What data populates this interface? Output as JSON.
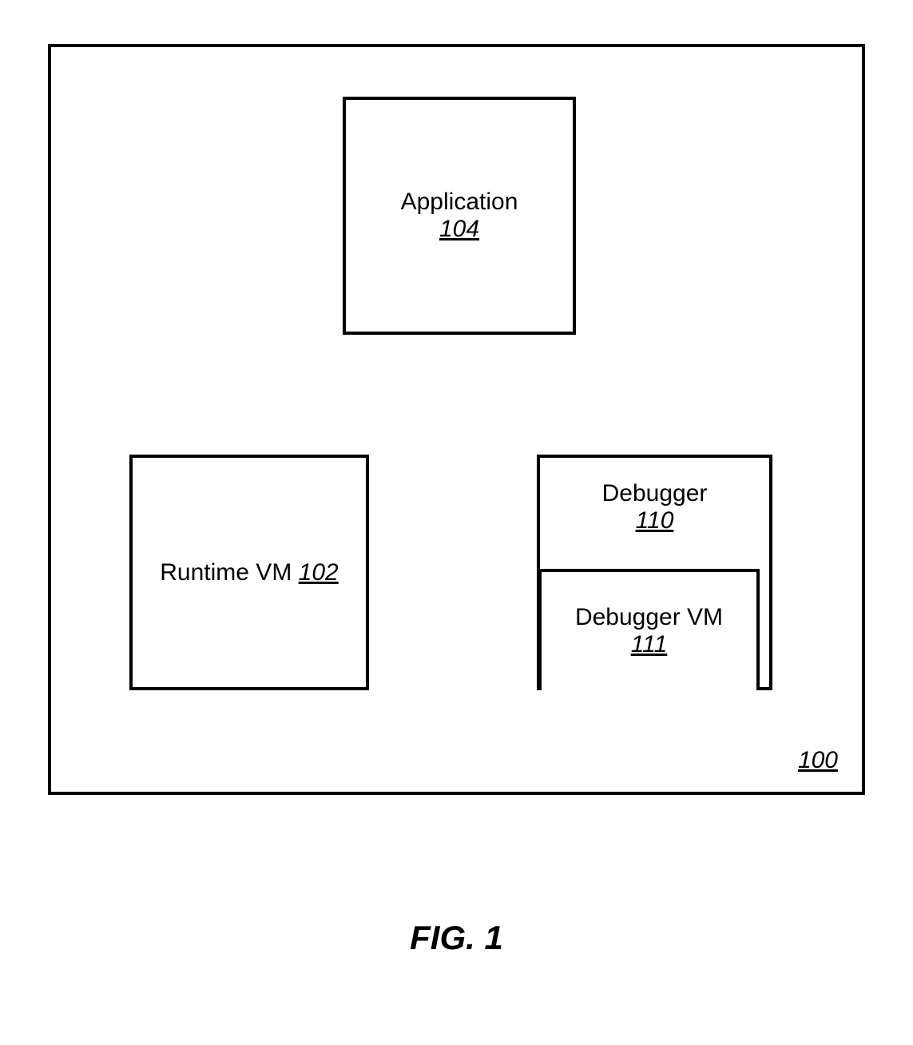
{
  "diagram": {
    "containerRef": "100",
    "application": {
      "label": "Application",
      "ref": "104"
    },
    "runtime": {
      "label": "Runtime VM",
      "ref": "102"
    },
    "debugger": {
      "label": "Debugger",
      "ref": "110"
    },
    "debuggerVm": {
      "label": "Debugger VM",
      "ref": "111"
    }
  },
  "caption": "FIG. 1"
}
